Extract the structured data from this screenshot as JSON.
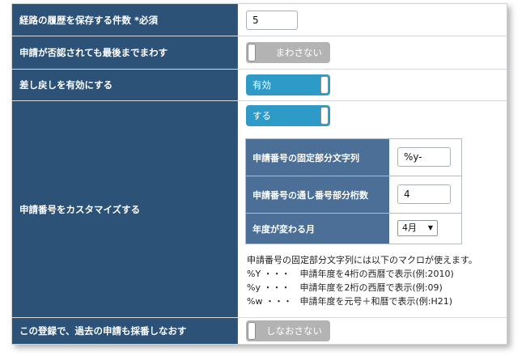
{
  "rows": {
    "history_count": {
      "label": "経路の履歴を保存する件数 *必須",
      "value": "5"
    },
    "continue_on_reject": {
      "label": "申請が否認されても最後までまわす",
      "toggle_text": "まわさない",
      "state": "off"
    },
    "enable_sendback": {
      "label": "差し戻しを有効にする",
      "toggle_text": "有効",
      "state": "on"
    },
    "customize_number": {
      "label": "申請番号をカスタマイズする",
      "toggle_text": "する",
      "state": "on",
      "subtable": {
        "fixed_part": {
          "label": "申請番号の固定部分文字列",
          "value": "%y-"
        },
        "serial_digits": {
          "label": "申請番号の通し番号部分桁数",
          "value": "4"
        },
        "year_change_month": {
          "label": "年度が変わる月",
          "selected": "4月"
        }
      },
      "notes": {
        "intro": "申請番号の固定部分文字列には以下のマクロが使えます。",
        "macros": [
          {
            "code": "%Y ・・・",
            "desc": "申請年度を4桁の西暦で表示(例:2010)"
          },
          {
            "code": "%y ・・・",
            "desc": "申請年度を2桁の西暦で表示(例:09)"
          },
          {
            "code": "%w ・・・",
            "desc": "申請年度を元号＋和暦で表示(例:H21)"
          }
        ]
      }
    },
    "renumber": {
      "label": "この登録で、過去の申請も採番しなおす",
      "toggle_text": "しなおさない",
      "state": "off"
    }
  },
  "colors": {
    "label_bg": "#2d5277",
    "sublabel_bg": "#4b6f97",
    "toggle_on": "#2e9ac8",
    "toggle_off": "#b3b3b3"
  }
}
